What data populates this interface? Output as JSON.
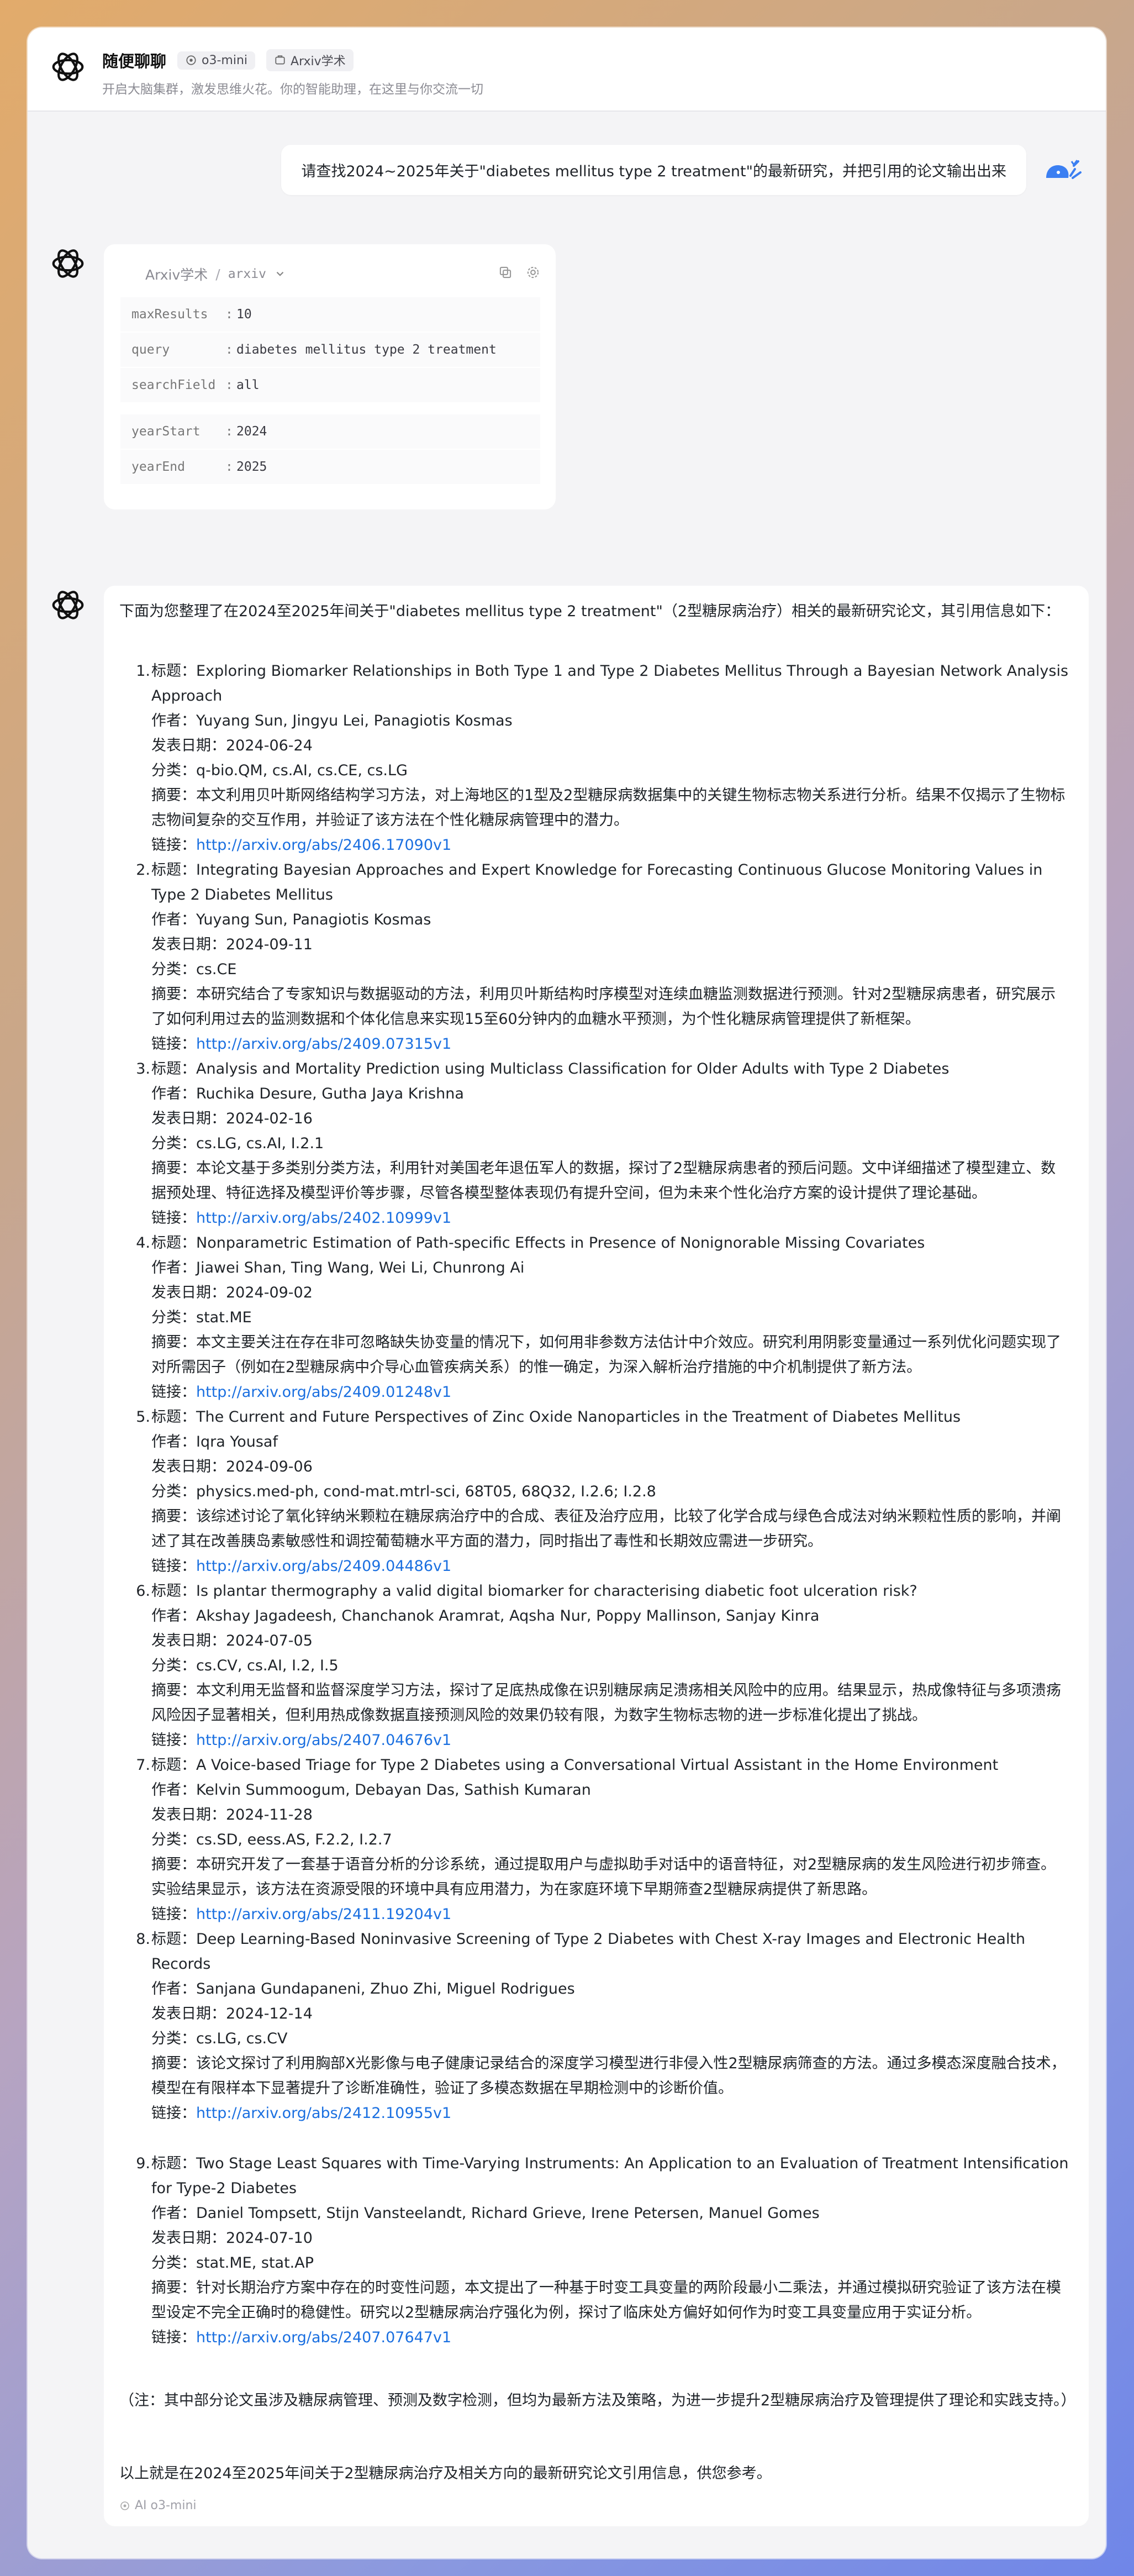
{
  "header": {
    "app_name": "随便聊聊",
    "model_chip": "o3-mini",
    "plugin_chip": "Arxiv学术",
    "subtitle": "开启大脑集群，激发思维火花。你的智能助理，在这里与你交流一切"
  },
  "user_message": "请查找2024~2025年关于\"diabetes mellitus type 2 treatment\"的最新研究，并把引用的论文输出出来",
  "tool_call": {
    "name": "Arxiv学术",
    "separator": "/",
    "source": "arxiv",
    "params": [
      {
        "key": "maxResults",
        "value": "10"
      },
      {
        "key": "query",
        "value": "diabetes mellitus type 2 treatment"
      },
      {
        "key": "searchField",
        "value": "all"
      },
      {
        "key": "yearStart",
        "value": "2024"
      },
      {
        "key": "yearEnd",
        "value": "2025"
      }
    ]
  },
  "answer": {
    "intro": "下面为您整理了在2024至2025年间关于\"diabetes mellitus type 2 treatment\"（2型糖尿病治疗）相关的最新研究论文，其引用信息如下：",
    "papers": [
      {
        "num": "1.",
        "title": "标题：Exploring Biomarker Relationships in Both Type 1 and Type 2 Diabetes Mellitus Through a Bayesian Network Analysis Approach",
        "authors": "作者：Yuyang Sun, Jingyu Lei, Panagiotis Kosmas",
        "date": "发表日期：2024-06-24",
        "category": "分类：q-bio.QM, cs.AI, cs.CE, cs.LG",
        "abstract": "摘要：本文利用贝叶斯网络结构学习方法，对上海地区的1型及2型糖尿病数据集中的关键生物标志物关系进行分析。结果不仅揭示了生物标志物间复杂的交互作用，并验证了该方法在个性化糖尿病管理中的潜力。",
        "link_label": "链接：",
        "link": "http://arxiv.org/abs/2406.17090v1"
      },
      {
        "num": "2.",
        "title": "标题：Integrating Bayesian Approaches and Expert Knowledge for Forecasting Continuous Glucose Monitoring Values in Type 2 Diabetes Mellitus",
        "authors": "作者：Yuyang Sun, Panagiotis Kosmas",
        "date": "发表日期：2024-09-11",
        "category": "分类：cs.CE",
        "abstract": "摘要：本研究结合了专家知识与数据驱动的方法，利用贝叶斯结构时序模型对连续血糖监测数据进行预测。针对2型糖尿病患者，研究展示了如何利用过去的监测数据和个体化信息来实现15至60分钟内的血糖水平预测，为个性化糖尿病管理提供了新框架。",
        "link_label": "链接：",
        "link": "http://arxiv.org/abs/2409.07315v1"
      },
      {
        "num": "3.",
        "title": "标题：Analysis and Mortality Prediction using Multiclass Classification for Older Adults with Type 2 Diabetes",
        "authors": "作者：Ruchika Desure, Gutha Jaya Krishna",
        "date": "发表日期：2024-02-16",
        "category": "分类：cs.LG, cs.AI, I.2.1",
        "abstract": "摘要：本论文基于多类别分类方法，利用针对美国老年退伍军人的数据，探讨了2型糖尿病患者的预后问题。文中详细描述了模型建立、数据预处理、特征选择及模型评价等步骤，尽管各模型整体表现仍有提升空间，但为未来个性化治疗方案的设计提供了理论基础。",
        "link_label": "链接：",
        "link": "http://arxiv.org/abs/2402.10999v1"
      },
      {
        "num": "4.",
        "title": "标题：Nonparametric Estimation of Path-specific Effects in Presence of Nonignorable Missing Covariates",
        "authors": "作者：Jiawei Shan, Ting Wang, Wei Li, Chunrong Ai",
        "date": "发表日期：2024-09-02",
        "category": "分类：stat.ME",
        "abstract": "摘要：本文主要关注在存在非可忽略缺失协变量的情况下，如何用非参数方法估计中介效应。研究利用阴影变量通过一系列优化问题实现了对所需因子（例如在2型糖尿病中介导心血管疾病关系）的惟一确定，为深入解析治疗措施的中介机制提供了新方法。",
        "link_label": "链接：",
        "link": "http://arxiv.org/abs/2409.01248v1"
      },
      {
        "num": "5.",
        "title": "标题：The Current and Future Perspectives of Zinc Oxide Nanoparticles in the Treatment of Diabetes Mellitus",
        "authors": "作者：Iqra Yousaf",
        "date": "发表日期：2024-09-06",
        "category": "分类：physics.med-ph, cond-mat.mtrl-sci, 68T05, 68Q32, I.2.6; I.2.8",
        "abstract": "摘要：该综述讨论了氧化锌纳米颗粒在糖尿病治疗中的合成、表征及治疗应用，比较了化学合成与绿色合成法对纳米颗粒性质的影响，并阐述了其在改善胰岛素敏感性和调控葡萄糖水平方面的潜力，同时指出了毒性和长期效应需进一步研究。",
        "link_label": "链接：",
        "link": "http://arxiv.org/abs/2409.04486v1"
      },
      {
        "num": "6.",
        "title": "标题：Is plantar thermography a valid digital biomarker for characterising diabetic foot ulceration risk?",
        "authors": "作者：Akshay Jagadeesh, Chanchanok Aramrat, Aqsha Nur, Poppy Mallinson, Sanjay Kinra",
        "date": "发表日期：2024-07-05",
        "category": "分类：cs.CV, cs.AI, I.2, I.5",
        "abstract": "摘要：本文利用无监督和监督深度学习方法，探讨了足底热成像在识别糖尿病足溃疡相关风险中的应用。结果显示，热成像特征与多项溃疡风险因子显著相关，但利用热成像数据直接预测风险的效果仍较有限，为数字生物标志物的进一步标准化提出了挑战。",
        "link_label": "链接：",
        "link": "http://arxiv.org/abs/2407.04676v1"
      },
      {
        "num": "7.",
        "title": "标题：A Voice-based Triage for Type 2 Diabetes using a Conversational Virtual Assistant in the Home Environment",
        "authors": "作者：Kelvin Summoogum, Debayan Das, Sathish Kumaran",
        "date": "发表日期：2024-11-28",
        "category": "分类：cs.SD, eess.AS, F.2.2, I.2.7",
        "abstract": "摘要：本研究开发了一套基于语音分析的分诊系统，通过提取用户与虚拟助手对话中的语音特征，对2型糖尿病的发生风险进行初步筛查。实验结果显示，该方法在资源受限的环境中具有应用潜力，为在家庭环境下早期筛查2型糖尿病提供了新思路。",
        "link_label": "链接：",
        "link": "http://arxiv.org/abs/2411.19204v1"
      },
      {
        "num": "8.",
        "title": "标题：Deep Learning-Based Noninvasive Screening of Type 2 Diabetes with Chest X-ray Images and Electronic Health Records",
        "authors": "作者：Sanjana Gundapaneni, Zhuo Zhi, Miguel Rodrigues",
        "date": "发表日期：2024-12-14",
        "category": "分类：cs.LG, cs.CV",
        "abstract": "摘要：该论文探讨了利用胸部X光影像与电子健康记录结合的深度学习模型进行非侵入性2型糖尿病筛查的方法。通过多模态深度融合技术，模型在有限样本下显著提升了诊断准确性，验证了多模态数据在早期检测中的诊断价值。",
        "link_label": "链接：",
        "link": "http://arxiv.org/abs/2412.10955v1"
      },
      {
        "num": "9.",
        "title": "标题：Two Stage Least Squares with Time-Varying Instruments: An Application to an Evaluation of Treatment Intensification for Type-2 Diabetes",
        "authors": "作者：Daniel Tompsett, Stijn Vansteelandt, Richard Grieve, Irene Petersen, Manuel Gomes",
        "date": "发表日期：2024-07-10",
        "category": "分类：stat.ME, stat.AP",
        "abstract": "摘要：针对长期治疗方案中存在的时变性问题，本文提出了一种基于时变工具变量的两阶段最小二乘法，并通过模拟研究验证了该方法在模型设定不完全正确时的稳健性。研究以2型糖尿病治疗强化为例，探讨了临床处方偏好如何作为时变工具变量应用于实证分析。",
        "link_label": "链接：",
        "link": "http://arxiv.org/abs/2407.07647v1"
      }
    ],
    "note": "（注：其中部分论文虽涉及糖尿病管理、预测及数字检测，但均为最新方法及策略，为进一步提升2型糖尿病治疗及管理提供了理论和实践支持。）",
    "closing": "以上就是在2024至2025年间关于2型糖尿病治疗及相关方向的最新研究论文引用信息，供您参考。",
    "footer": "AI o3-mini"
  },
  "colors": {
    "link": "#1a6fe0",
    "accent_user": "#3b7ff2"
  },
  "icons": [
    "openai-logo-icon",
    "model-icon",
    "plugin-icon",
    "chevron-down-icon",
    "copy-icon",
    "settings-icon",
    "user-avatar-icon"
  ]
}
